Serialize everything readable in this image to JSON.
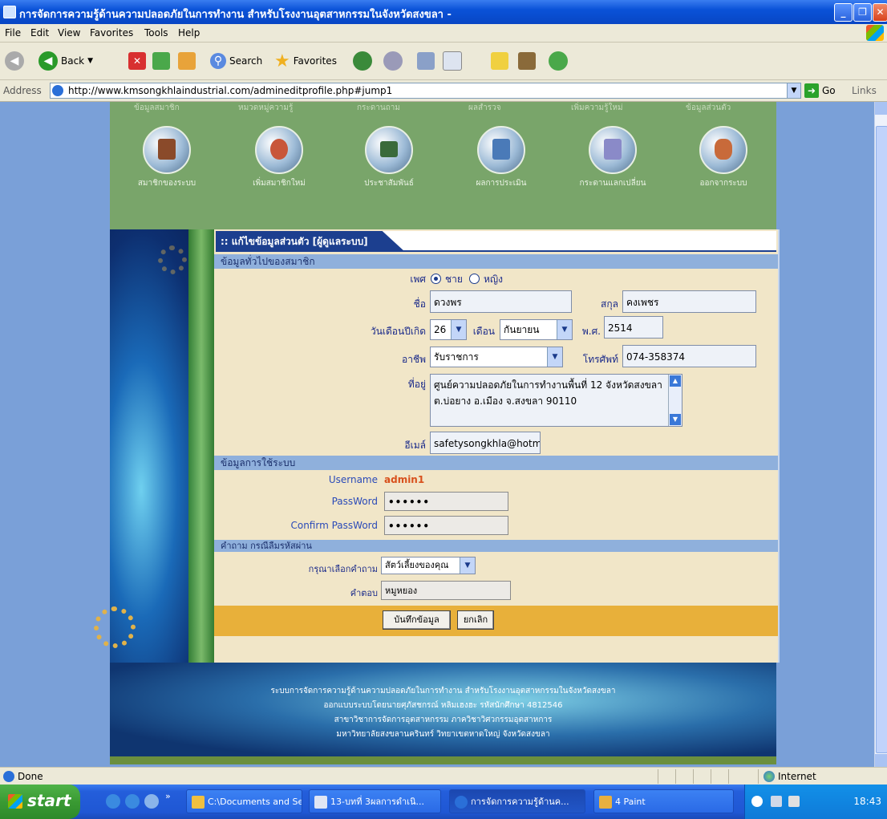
{
  "window": {
    "title": "การจัดการความรู้ด้านความปลอดภัยในการทำงาน สำหรับโรงงานอุตสาหกรรมในจังหวัดสงขลา -"
  },
  "menu": [
    "File",
    "Edit",
    "View",
    "Favorites",
    "Tools",
    "Help"
  ],
  "toolbar": {
    "back_label": "Back",
    "search_label": "Search",
    "favorites_label": "Favorites"
  },
  "address": {
    "label": "Address",
    "url": "http://www.kmsongkhlaindustrial.com/admineditprofile.php#jump1",
    "go_label": "Go",
    "links_label": "Links"
  },
  "nav": {
    "top_labels": [
      "ข้อมูลสมาชิก",
      "หมวดหมู่ความรู้",
      "กระดานถาม",
      "ผลสำรวจ",
      "เพิ่มความรู้ใหม่",
      "ข้อมูลส่วนตัว"
    ],
    "items": [
      {
        "label": "สมาชิกของระบบ",
        "icon": "members-icon"
      },
      {
        "label": "เพิ่มสมาชิกใหม่",
        "icon": "add-member-icon"
      },
      {
        "label": "ประชาสัมพันธ์",
        "icon": "announcement-icon"
      },
      {
        "label": "ผลการประเมิน",
        "icon": "evaluation-icon"
      },
      {
        "label": "กระดานแลกเปลี่ยน",
        "icon": "board-icon"
      },
      {
        "label": "ออกจากระบบ",
        "icon": "logout-icon"
      }
    ]
  },
  "form": {
    "heading": ":: แก้ไขข้อมูลส่วนตัว [ผู้ดูแลระบบ]",
    "section_general": "ข้อมูลทั่วไปของสมาชิก",
    "gender_label": "เพศ",
    "gender_male": "ชาย",
    "gender_female": "หญิง",
    "first_name_label": "ชื่อ",
    "first_name": "ดวงพร",
    "last_name_label": "สกุล",
    "last_name": "คงเพชร",
    "birth_label": "วันเดือนปีเกิด",
    "birth_day": "26",
    "birth_month_label": "เดือน",
    "birth_month": "กันยายน",
    "birth_year_label": "พ.ศ.",
    "birth_year": "2514",
    "job_label": "อาชีพ",
    "job": "รับราชการ",
    "phone_label": "โทรศัพท์",
    "phone": "074-358374",
    "address_label": "ที่อยู่",
    "address_line1": "ศูนย์ความปลอดภัยในการทำงานพื้นที่ 12 จังหวัดสงขลา",
    "address_line2": "ต.บ่อยาง อ.เมือง จ.สงขลา 90110",
    "email_label": "อีเมล์",
    "email": "safetysongkhla@hotma",
    "section_system": "ข้อมูลการใช้ระบบ",
    "username_label": "Username",
    "username": "admin1",
    "password_label": "PassWord",
    "password": "••••••",
    "confirm_label": "Confirm PassWord",
    "confirm": "••••••",
    "section_question": "คำถาม กรณีลืมรหัสผ่าน",
    "question_label": "กรุณาเลือกคำถาม",
    "question": "สัตว์เลี้ยงของคุณ",
    "answer_label": "คำตอบ",
    "answer": "หมูหยอง",
    "save_label": "บันทึกข้อมูล",
    "cancel_label": "ยกเลิก"
  },
  "footer": {
    "lines": [
      "ระบบการจัดการความรู้ด้านความปลอดภัยในการทำงาน สำหรับโรงงานอุตสาหกรรมในจังหวัดสงขลา",
      "ออกแบบระบบโดยนายศุภัสชกรณ์ หลิมเฮงฮะ รหัสนักศึกษา 4812546",
      "สาขาวิชาการจัดการอุตสาหกรรม ภาควิชาวิศวกรรมอุตสาหการ",
      "มหาวิทยาลัยสงขลานครินทร์ วิทยาเขตหาดใหญ่ จังหวัดสงขลา"
    ]
  },
  "status": {
    "text": "Done",
    "zone": "Internet"
  },
  "taskbar": {
    "start_label": "start",
    "buttons": [
      {
        "label": "C:\\Documents and Se..."
      },
      {
        "label": "13-บทที่ 3ผลการดำเนิ..."
      },
      {
        "label": "การจัดการความรู้ด้านค..."
      },
      {
        "label": "4 Paint"
      }
    ],
    "clock": "18:43"
  }
}
